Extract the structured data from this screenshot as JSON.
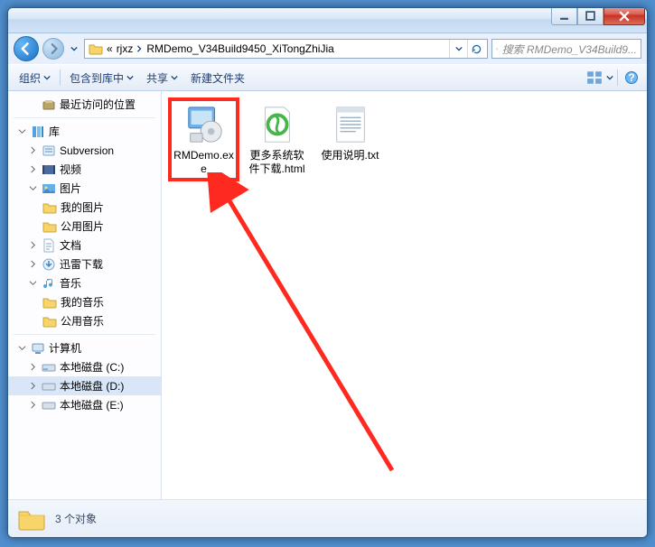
{
  "breadcrumb": {
    "prefix": "«",
    "parts": [
      "rjxz",
      "RMDemo_V34Build9450_XiTongZhiJia"
    ]
  },
  "search": {
    "placeholder": "搜索 RMDemo_V34Build9..."
  },
  "toolbar": {
    "organize": "组织",
    "include": "包含到库中",
    "share": "共享",
    "newfolder": "新建文件夹"
  },
  "sidebar": {
    "recent": "最近访问的位置",
    "lib": "库",
    "subversion": "Subversion",
    "video": "视频",
    "pictures": "图片",
    "my_pictures": "我的图片",
    "public_pictures": "公用图片",
    "documents": "文档",
    "xunlei": "迅雷下载",
    "music": "音乐",
    "my_music": "我的音乐",
    "public_music": "公用音乐",
    "computer": "计算机",
    "disk_c": "本地磁盘 (C:)",
    "disk_d": "本地磁盘 (D:)",
    "disk_e": "本地磁盘 (E:)"
  },
  "files": [
    {
      "name": "RMDemo.exe"
    },
    {
      "name": "更多系统软件下载.html"
    },
    {
      "name": "使用说明.txt"
    }
  ],
  "status": {
    "text": "3 个对象"
  }
}
